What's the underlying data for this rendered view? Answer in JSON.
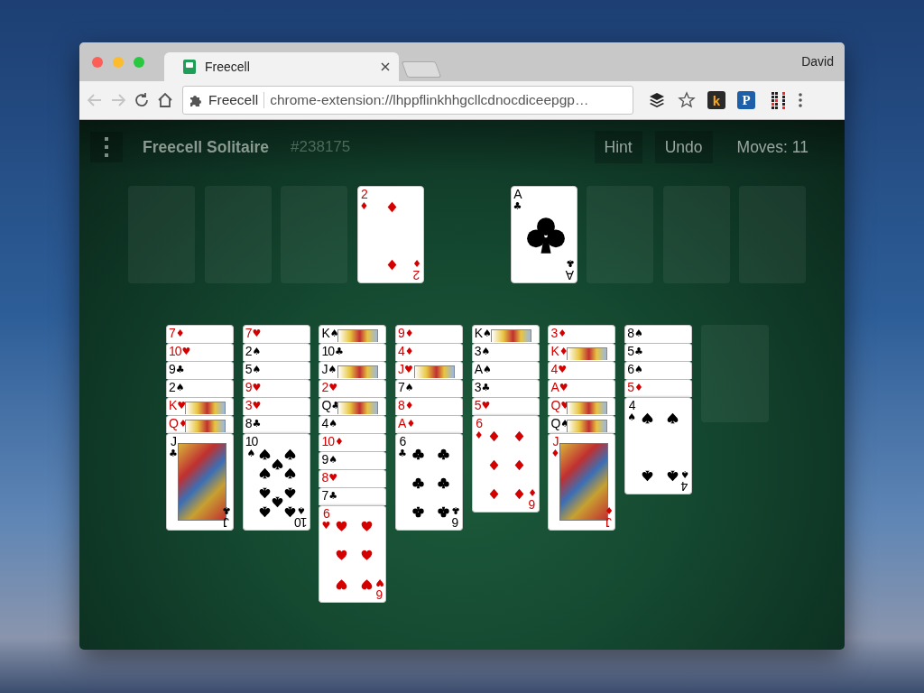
{
  "browser": {
    "tab": {
      "title": "Freecell"
    },
    "profile": "David",
    "back": {
      "disabled": true
    },
    "forward": {
      "disabled": true
    },
    "omnibox": {
      "site_label": "Freecell",
      "url": "chrome-extension://lhppflinkhhgcllcdnocdiceepgp…"
    },
    "extensions": [
      {
        "kind": "layers"
      },
      {
        "kind": "star"
      },
      {
        "kind": "letter",
        "text": "k"
      },
      {
        "kind": "letter",
        "text": "P"
      },
      {
        "kind": "grid"
      },
      {
        "kind": "menu"
      }
    ]
  },
  "game": {
    "title": "Freecell Solitaire",
    "number": "#238175",
    "buttons": [
      "Hint",
      "Undo"
    ],
    "moves": "Moves: 11"
  },
  "free_cells": [
    {
      "kind": "empty"
    },
    {
      "kind": "empty"
    },
    {
      "kind": "empty"
    },
    {
      "kind": "card",
      "card": {
        "rank": "2",
        "suit": "♦",
        "color": "#d40000",
        "kind": "diamond",
        "bottom": {
          "rank": "2",
          "suit": "♦"
        }
      }
    }
  ],
  "foundations": [
    {
      "kind": "card",
      "card": {
        "rank": "A",
        "suit": "♣",
        "color": "#000000",
        "kind": "club",
        "bottom": {
          "rank": "A",
          "suit": "♣"
        }
      }
    },
    {
      "kind": "empty"
    },
    {
      "kind": "empty"
    },
    {
      "kind": "empty"
    }
  ],
  "tableau": [
    {
      "kind": "stack",
      "cards": [
        {
          "rank": "7",
          "suit": "♦",
          "color": "#d40000"
        },
        {
          "rank": "10",
          "suit": "♥",
          "color": "#d40000"
        },
        {
          "rank": "9",
          "suit": "♣",
          "color": "#000000"
        },
        {
          "rank": "2",
          "suit": "♠",
          "color": "#000000"
        },
        {
          "rank": "K",
          "suit": "♥",
          "color": "#d40000",
          "face": true
        },
        {
          "rank": "Q",
          "suit": "♦",
          "color": "#d40000",
          "face": true
        },
        {
          "rank": "J",
          "suit": "♣",
          "color": "#000000",
          "face": true,
          "bottom": {
            "rank": "J",
            "suit": "♣"
          }
        }
      ]
    },
    {
      "kind": "stack",
      "cards": [
        {
          "rank": "7",
          "suit": "♥",
          "color": "#d40000"
        },
        {
          "rank": "2",
          "suit": "♠",
          "color": "#000000"
        },
        {
          "rank": "5",
          "suit": "♠",
          "color": "#000000"
        },
        {
          "rank": "9",
          "suit": "♥",
          "color": "#d40000"
        },
        {
          "rank": "3",
          "suit": "♥",
          "color": "#d40000"
        },
        {
          "rank": "8",
          "suit": "♣",
          "color": "#000000"
        },
        {
          "rank": "10",
          "suit": "♠",
          "color": "#000000",
          "kind": "spade",
          "bottom": {
            "rank": "10",
            "suit": "♠"
          }
        }
      ]
    },
    {
      "kind": "stack",
      "cards": [
        {
          "rank": "K",
          "suit": "♠",
          "color": "#000000",
          "face": true
        },
        {
          "rank": "10",
          "suit": "♣",
          "color": "#000000"
        },
        {
          "rank": "J",
          "suit": "♠",
          "color": "#000000",
          "face": true
        },
        {
          "rank": "2",
          "suit": "♥",
          "color": "#d40000"
        },
        {
          "rank": "Q",
          "suit": "♣",
          "color": "#000000",
          "face": true
        },
        {
          "rank": "4",
          "suit": "♠",
          "color": "#000000"
        },
        {
          "rank": "10",
          "suit": "♦",
          "color": "#d40000"
        },
        {
          "rank": "9",
          "suit": "♠",
          "color": "#000000"
        },
        {
          "rank": "8",
          "suit": "♥",
          "color": "#d40000"
        },
        {
          "rank": "7",
          "suit": "♣",
          "color": "#000000"
        },
        {
          "rank": "6",
          "suit": "♥",
          "color": "#d40000",
          "kind": "heart",
          "bottom": {
            "rank": "6",
            "suit": "♥"
          }
        }
      ]
    },
    {
      "kind": "stack",
      "cards": [
        {
          "rank": "9",
          "suit": "♦",
          "color": "#d40000"
        },
        {
          "rank": "4",
          "suit": "♦",
          "color": "#d40000"
        },
        {
          "rank": "J",
          "suit": "♥",
          "color": "#d40000",
          "face": true
        },
        {
          "rank": "7",
          "suit": "♠",
          "color": "#000000"
        },
        {
          "rank": "8",
          "suit": "♦",
          "color": "#d40000"
        },
        {
          "rank": "A",
          "suit": "♦",
          "color": "#d40000"
        },
        {
          "rank": "6",
          "suit": "♣",
          "color": "#000000",
          "kind": "club",
          "bottom": {
            "rank": "6",
            "suit": "♣"
          }
        }
      ]
    },
    {
      "kind": "stack",
      "cards": [
        {
          "rank": "K",
          "suit": "♠",
          "color": "#000000",
          "face": true
        },
        {
          "rank": "3",
          "suit": "♠",
          "color": "#000000"
        },
        {
          "rank": "A",
          "suit": "♠",
          "color": "#000000"
        },
        {
          "rank": "3",
          "suit": "♣",
          "color": "#000000"
        },
        {
          "rank": "5",
          "suit": "♥",
          "color": "#d40000"
        },
        {
          "rank": "6",
          "suit": "♦",
          "color": "#d40000",
          "kind": "diamond",
          "bottom": {
            "rank": "6",
            "suit": "♦"
          }
        }
      ]
    },
    {
      "kind": "stack",
      "cards": [
        {
          "rank": "3",
          "suit": "♦",
          "color": "#d40000"
        },
        {
          "rank": "K",
          "suit": "♦",
          "color": "#d40000",
          "face": true
        },
        {
          "rank": "4",
          "suit": "♥",
          "color": "#d40000"
        },
        {
          "rank": "A",
          "suit": "♥",
          "color": "#d40000"
        },
        {
          "rank": "Q",
          "suit": "♥",
          "color": "#d40000",
          "face": true
        },
        {
          "rank": "Q",
          "suit": "♠",
          "color": "#000000",
          "face": true
        },
        {
          "rank": "J",
          "suit": "♦",
          "color": "#d40000",
          "face": true,
          "bottom": {
            "rank": "J",
            "suit": "♦"
          }
        }
      ]
    },
    {
      "kind": "stack",
      "cards": [
        {
          "rank": "8",
          "suit": "♠",
          "color": "#000000"
        },
        {
          "rank": "5",
          "suit": "♣",
          "color": "#000000"
        },
        {
          "rank": "6",
          "suit": "♠",
          "color": "#000000"
        },
        {
          "rank": "5",
          "suit": "♦",
          "color": "#d40000"
        },
        {
          "rank": "4",
          "suit": "♠",
          "color": "#000000",
          "kind": "spade",
          "bottom": {
            "rank": "4",
            "suit": "♠"
          }
        }
      ]
    },
    {
      "kind": "empty"
    }
  ]
}
